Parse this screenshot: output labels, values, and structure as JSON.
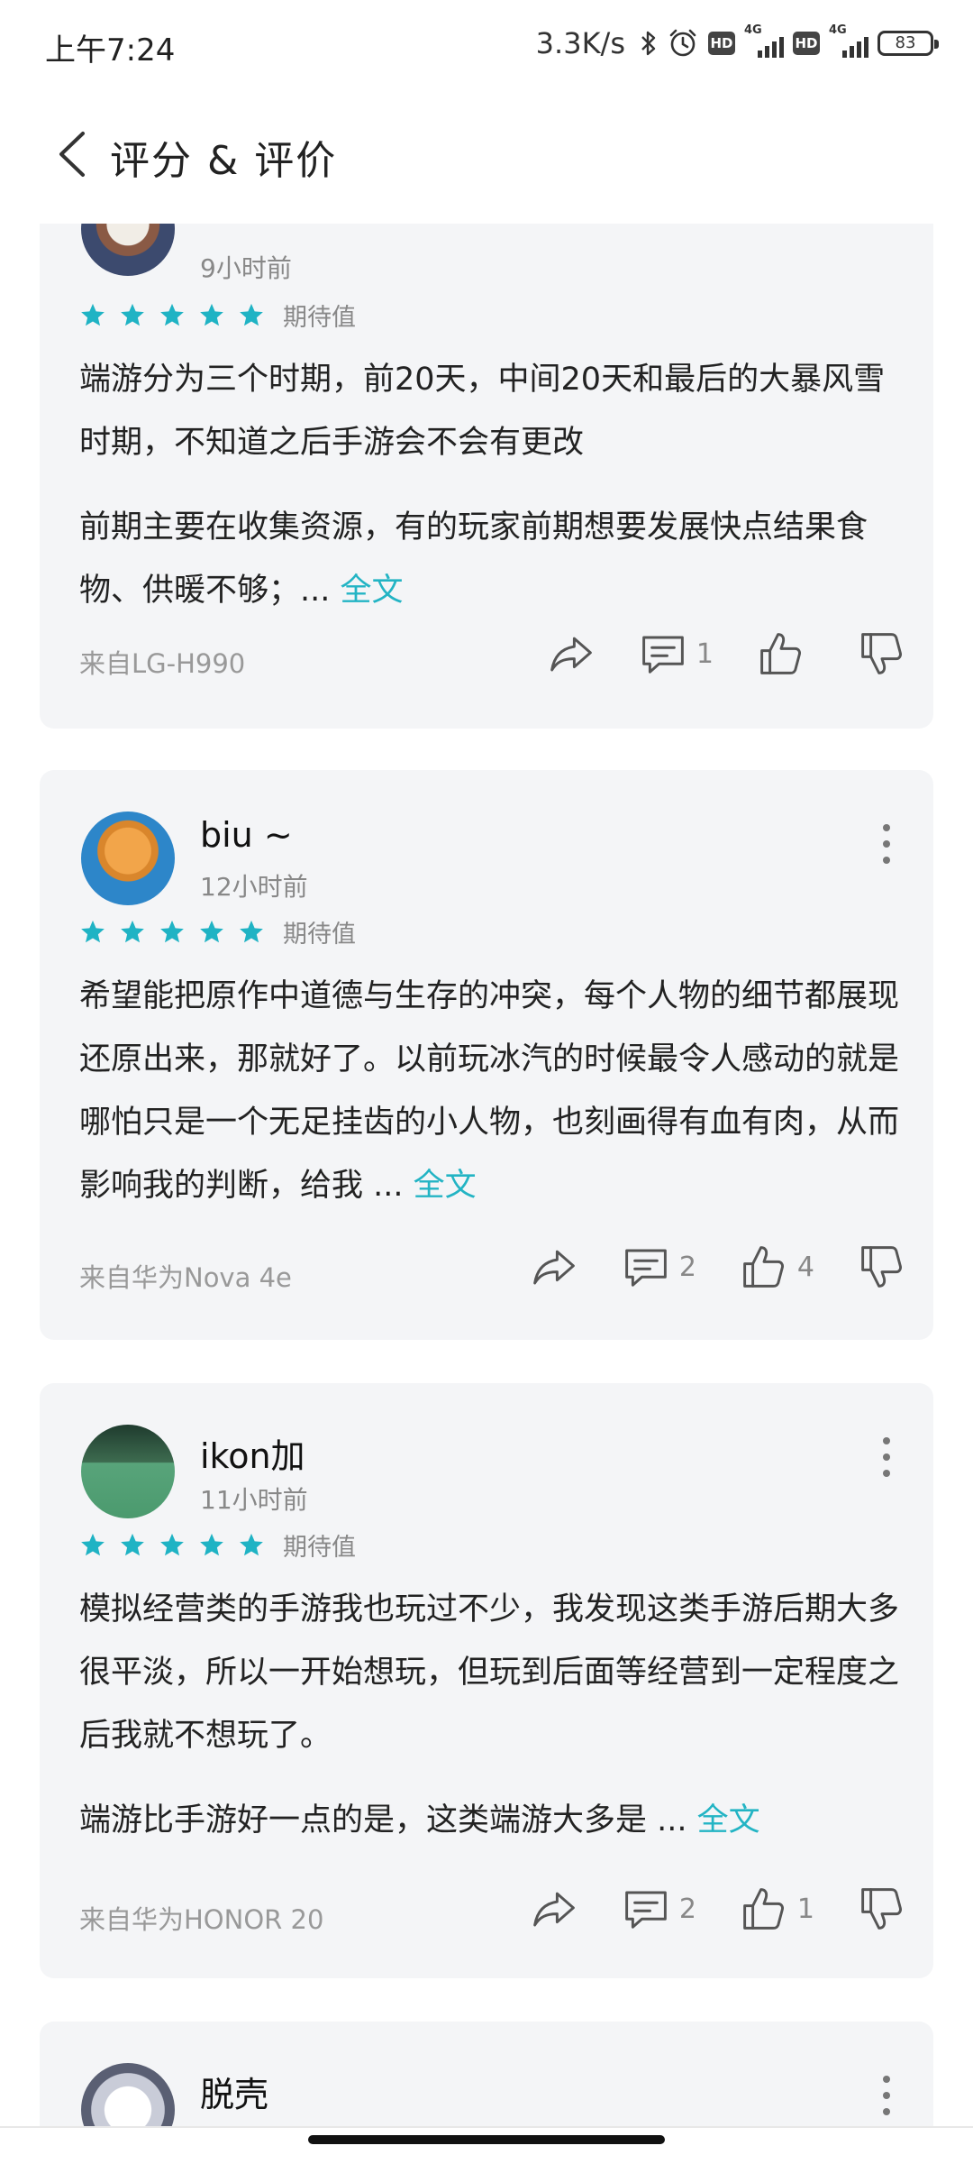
{
  "status_bar": {
    "time": "上午7:24",
    "speed": "3.3K/s",
    "hd_badge": "HD",
    "network": "4G",
    "battery": "83"
  },
  "header": {
    "title": "评分 & 评价"
  },
  "reviews": [
    {
      "time": "9小时前",
      "rating": 5,
      "tag": "期待值",
      "paragraphs": [
        "端游分为三个时期，前20天，中间20天和最后的大暴风雪时期，不知道之后手游会不会有更改",
        "前期主要在收集资源，有的玩家前期想要发展快点结果食物、供暖不够；... "
      ],
      "full_label": "全文",
      "device": "来自LG-H990",
      "comments": "1",
      "likes": ""
    },
    {
      "username": "biu ~",
      "time": "12小时前",
      "rating": 5,
      "tag": "期待值",
      "paragraphs": [
        "希望能把原作中道德与生存的冲突，每个人物的细节都展现还原出来，那就好了。以前玩冰汽的时候最令人感动的就是哪怕只是一个无足挂齿的小人物，也刻画得有血有肉，从而影响我的判断，给我 ... "
      ],
      "full_label": "全文",
      "device": "来自华为Nova 4e",
      "comments": "2",
      "likes": "4"
    },
    {
      "username": "ikon加",
      "time": "11小时前",
      "rating": 5,
      "tag": "期待值",
      "paragraphs": [
        "模拟经营类的手游我也玩过不少，我发现这类手游后期大多很平淡，所以一开始想玩，但玩到后面等经营到一定程度之后我就不想玩了。",
        "端游比手游好一点的是，这类端游大多是 ... "
      ],
      "full_label": "全文",
      "device": "来自华为HONOR 20",
      "comments": "2",
      "likes": "1"
    },
    {
      "username": "脱壳"
    }
  ],
  "colors": {
    "accent": "#23b4c4",
    "card_bg": "#f4f5f7"
  },
  "icons": [
    "back-arrow-icon",
    "star-icon",
    "share-icon",
    "comment-icon",
    "thumbs-up-icon",
    "thumbs-down-icon",
    "more-icon"
  ]
}
